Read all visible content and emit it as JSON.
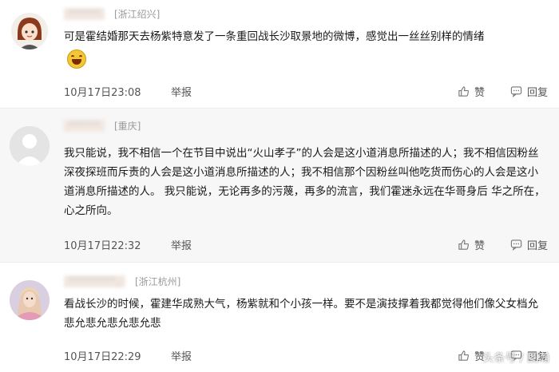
{
  "comments": [
    {
      "username": "******",
      "location": "[浙江绍兴]",
      "text": "可是霍结婚那天去杨紫特意发了一条重回战长沙取景地的微博，感觉出一丝丝别样的情绪",
      "time": "10月17日23:08",
      "report": "举报",
      "like": "赞",
      "reply": "回复"
    },
    {
      "username": "******",
      "location": "[重庆]",
      "text": "我只能说，我不相信一个在节目中说出“火山孝子”的人会是这小道消息所描述的人；我不相信因粉丝深夜探班而斥责的人会是这小道消息所描述的人；我不相信那个因粉丝叫他吃货而伤心的人会是这小道消息所描述的人。 我只能说，无论再多的污蔑，再多的流言，我们霍迷永远在华哥身后 华之所在，心之所向。",
      "time": "10月17日22:32",
      "report": "举报",
      "like": "赞",
      "reply": "回复"
    },
    {
      "username": "*********_",
      "location": "[浙江杭州]",
      "text": "看战长沙的时候，霍建华成熟大气，杨紫就和个小孩一样。要不是演技撑着我都觉得他们像父女档允悲允悲允悲允悲允悲",
      "time": "10月17日22:29",
      "report": "举报",
      "like": "赞",
      "reply": "回复"
    }
  ],
  "watermark": "头条号 / 图瀚",
  "icons": {
    "like": "thumbs-up-icon",
    "reply": "comment-bubble-icon",
    "emoji": "laughing-face-emoji"
  },
  "colors": {
    "accent_bg": "#f7f7f7",
    "divider": "#ececec",
    "emoji": "#f5c634"
  }
}
